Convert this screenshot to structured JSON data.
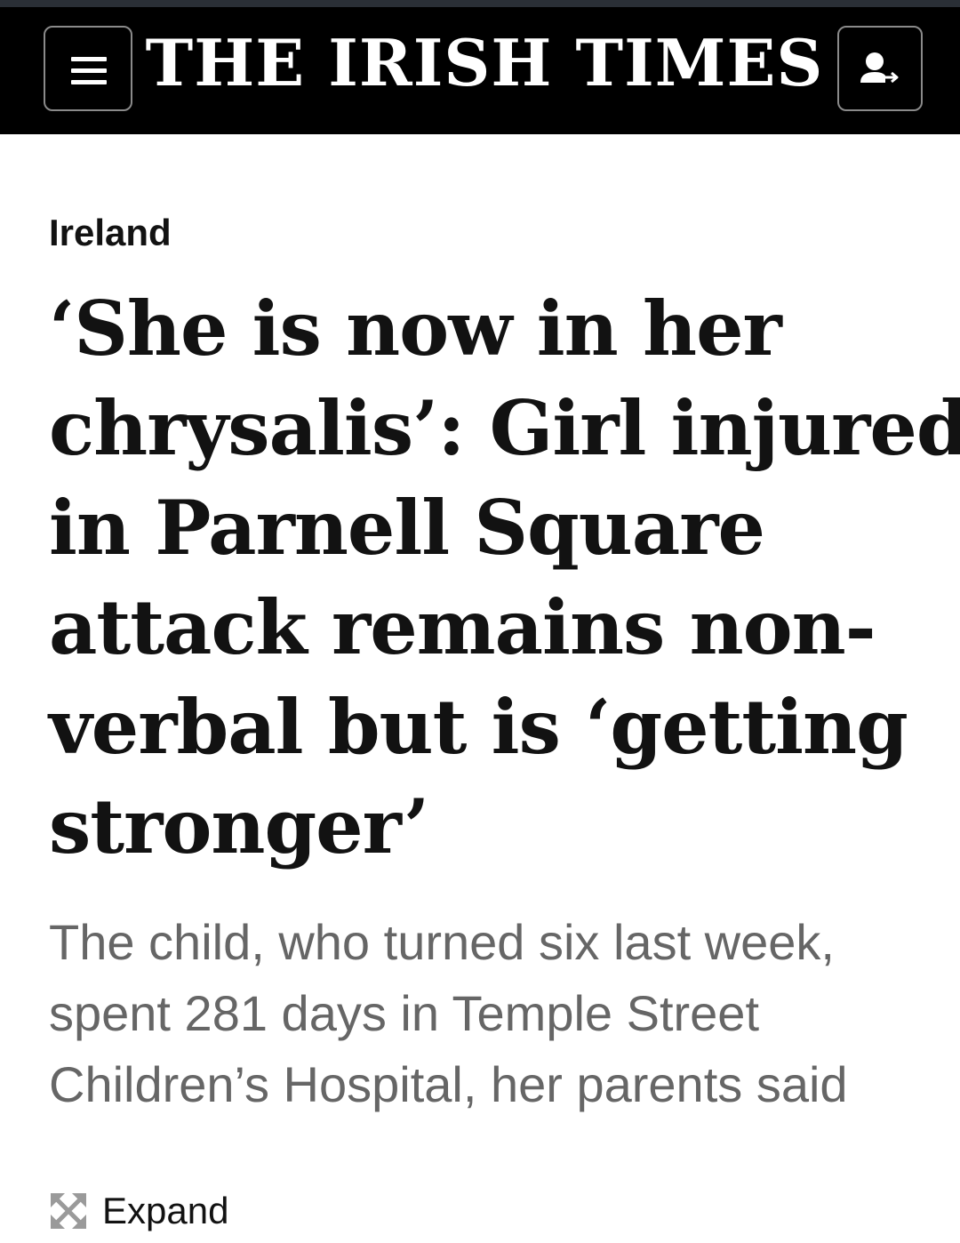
{
  "header": {
    "masthead": "THE IRISH TIMES",
    "menu_icon": "hamburger-menu-icon",
    "account_icon": "user-sign-in-icon",
    "background_color": "#000000",
    "text_color": "#ffffff"
  },
  "article": {
    "section": "Ireland",
    "headline_lines": [
      "‘She is now in her",
      "chrysalis’: Girl injured",
      "in Parnell Square",
      "attack remains non-",
      "verbal but is ‘getting",
      "stronger’"
    ],
    "standfirst_lines": [
      "The child, who turned six last week,",
      "spent 281 days in Temple Street",
      "Children’s Hospital, her parents said"
    ],
    "expand_label": "Expand",
    "expand_icon": "expand-arrows-icon"
  }
}
